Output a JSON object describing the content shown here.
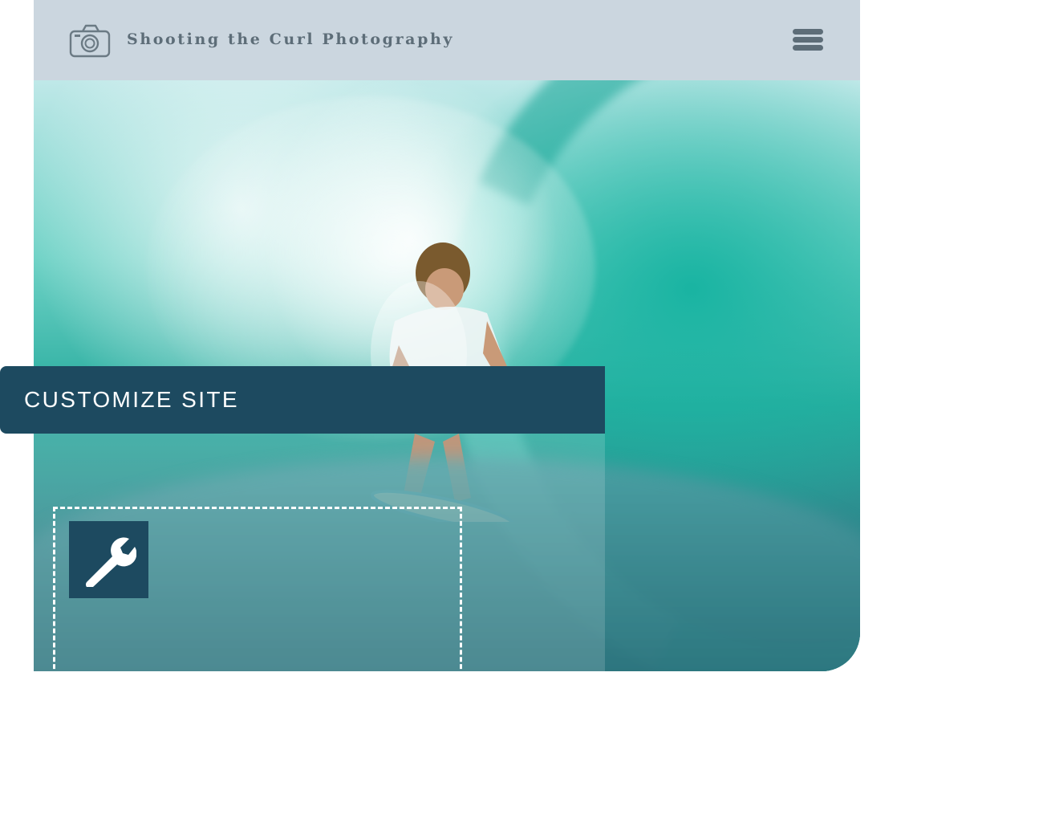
{
  "header": {
    "logo_icon": "camera-icon",
    "site_title": "Shooting the Curl Photography",
    "menu_icon": "hamburger-menu-icon"
  },
  "hero": {
    "image": "surfer-in-wave-photo"
  },
  "customize": {
    "label": "CUSTOMIZE SITE",
    "tool_icon": "wrench-icon"
  },
  "colors": {
    "header_bg": "#cbd6df",
    "header_text": "#5d6d78",
    "banner_bg": "#1d4a60",
    "banner_text": "#ffffff"
  }
}
